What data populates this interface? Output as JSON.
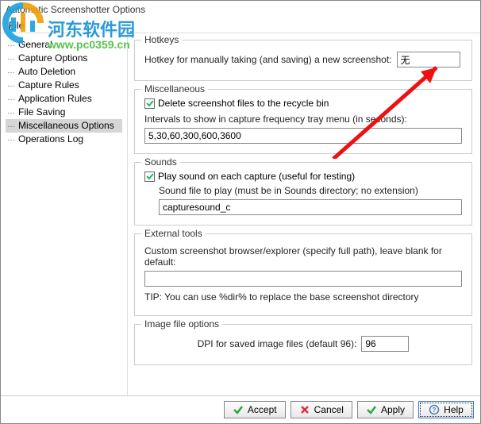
{
  "window": {
    "title": "Automatic Screenshotter Options",
    "menu_file": "File"
  },
  "sidebar": {
    "items": [
      {
        "label": "General"
      },
      {
        "label": "Capture Options"
      },
      {
        "label": "Auto Deletion"
      },
      {
        "label": "Capture Rules"
      },
      {
        "label": "Application Rules"
      },
      {
        "label": "File Saving"
      },
      {
        "label": "Miscellaneous Options",
        "selected": true
      },
      {
        "label": "Operations Log"
      }
    ]
  },
  "hotkeys": {
    "legend": "Hotkeys",
    "label": "Hotkey for manually taking (and saving) a new screenshot:",
    "value": "无"
  },
  "misc": {
    "legend": "Miscellaneous",
    "delete_label": "Delete screenshot files to the recycle bin",
    "delete_checked": true,
    "intervals_label": "Intervals to show in capture frequency tray menu (in seconds):",
    "intervals_value": "5,30,60,300,600,3600"
  },
  "sounds": {
    "legend": "Sounds",
    "play_label": "Play sound on each capture (useful for testing)",
    "play_checked": true,
    "file_label": "Sound file to play (must be in Sounds directory; no extension)",
    "file_value": "capturesound_c"
  },
  "ext": {
    "legend": "External tools",
    "label": "Custom screenshot browser/explorer (specify full path), leave blank for default:",
    "value": "",
    "tip": "TIP: You can use %dir% to replace the base screenshot directory"
  },
  "img": {
    "legend": "Image file options",
    "label": "DPI for saved image files (default 96):",
    "value": "96"
  },
  "buttons": {
    "accept": "Accept",
    "cancel": "Cancel",
    "apply": "Apply",
    "help": "Help"
  },
  "watermark": {
    "text1": "河东软件园",
    "text2": "www.pc0359.cn"
  }
}
